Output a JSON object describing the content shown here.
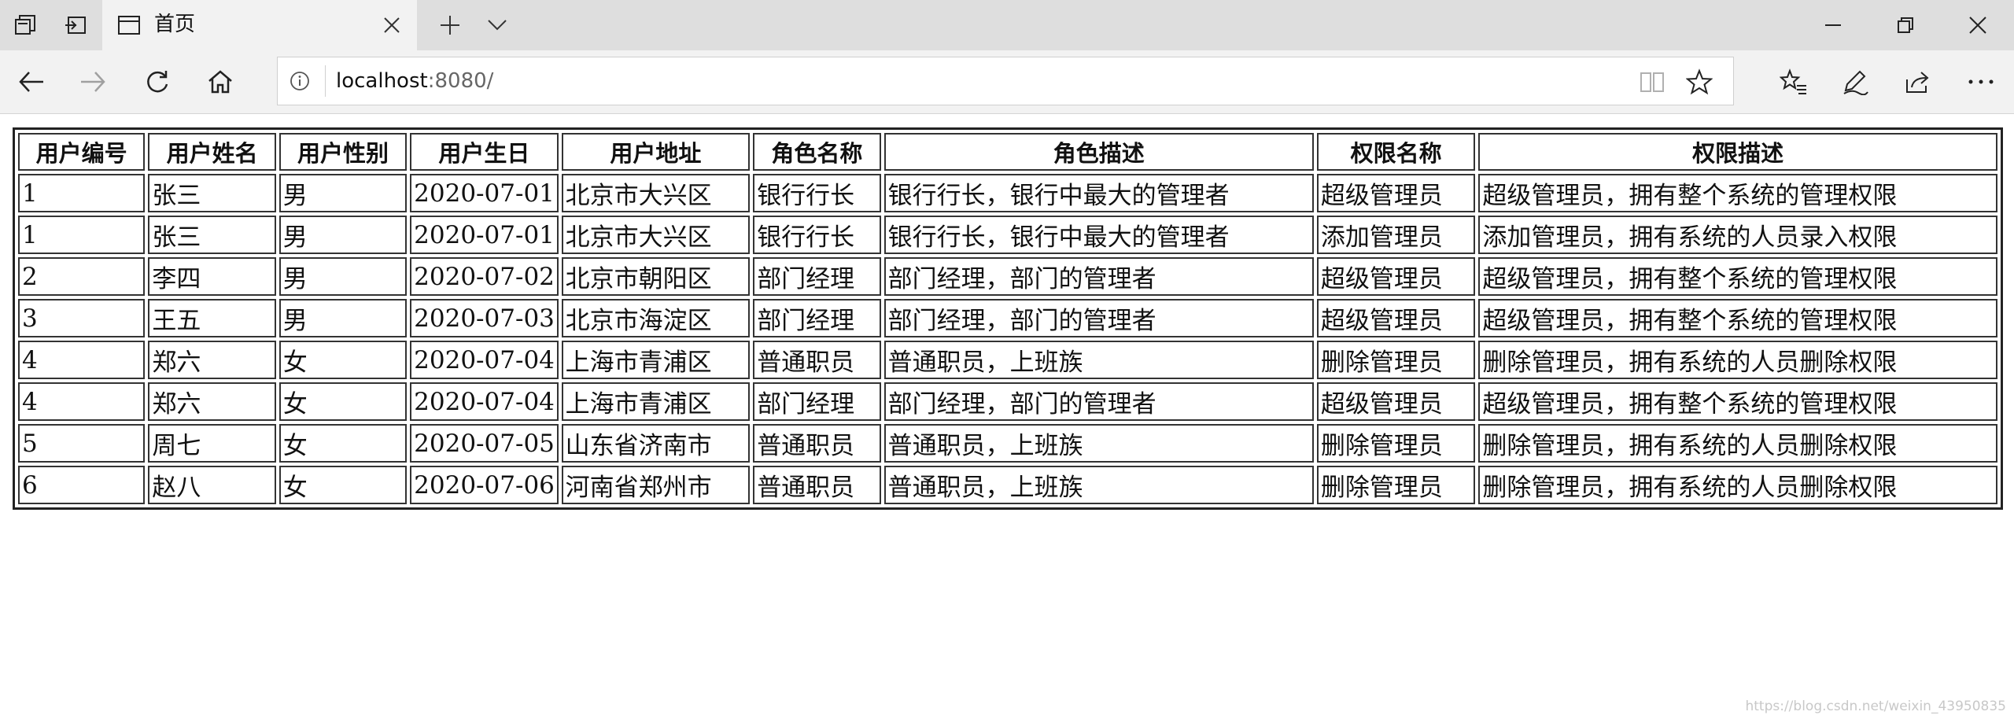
{
  "tab": {
    "title": "首页"
  },
  "address": {
    "host": "localhost",
    "port": ":8080/"
  },
  "table": {
    "headers": [
      "用户编号",
      "用户姓名",
      "用户性别",
      "用户生日",
      "用户地址",
      "角色名称",
      "角色描述",
      "权限名称",
      "权限描述"
    ],
    "rows": [
      [
        "1",
        "张三",
        "男",
        "2020-07-01",
        "北京市大兴区",
        "银行行长",
        "银行行长，银行中最大的管理者",
        "超级管理员",
        "超级管理员，拥有整个系统的管理权限"
      ],
      [
        "1",
        "张三",
        "男",
        "2020-07-01",
        "北京市大兴区",
        "银行行长",
        "银行行长，银行中最大的管理者",
        "添加管理员",
        "添加管理员，拥有系统的人员录入权限"
      ],
      [
        "2",
        "李四",
        "男",
        "2020-07-02",
        "北京市朝阳区",
        "部门经理",
        "部门经理，部门的管理者",
        "超级管理员",
        "超级管理员，拥有整个系统的管理权限"
      ],
      [
        "3",
        "王五",
        "男",
        "2020-07-03",
        "北京市海淀区",
        "部门经理",
        "部门经理，部门的管理者",
        "超级管理员",
        "超级管理员，拥有整个系统的管理权限"
      ],
      [
        "4",
        "郑六",
        "女",
        "2020-07-04",
        "上海市青浦区",
        "普通职员",
        "普通职员，上班族",
        "删除管理员",
        "删除管理员，拥有系统的人员删除权限"
      ],
      [
        "4",
        "郑六",
        "女",
        "2020-07-04",
        "上海市青浦区",
        "部门经理",
        "部门经理，部门的管理者",
        "超级管理员",
        "超级管理员，拥有整个系统的管理权限"
      ],
      [
        "5",
        "周七",
        "女",
        "2020-07-05",
        "山东省济南市",
        "普通职员",
        "普通职员，上班族",
        "删除管理员",
        "删除管理员，拥有系统的人员删除权限"
      ],
      [
        "6",
        "赵八",
        "女",
        "2020-07-06",
        "河南省郑州市",
        "普通职员",
        "普通职员，上班族",
        "删除管理员",
        "删除管理员，拥有系统的人员删除权限"
      ]
    ]
  },
  "watermark": "https://blog.csdn.net/weixin_43950835",
  "icons": {
    "tabs-aside": "tabs-aside-icon",
    "set-aside": "set-aside-icon",
    "page": "page-icon",
    "close": "close-icon",
    "new-tab": "plus-icon",
    "tab-menu": "chevron-down-icon",
    "minimize": "minimize-icon",
    "restore": "restore-icon",
    "window-close": "close-icon",
    "back": "arrow-left-icon",
    "forward": "arrow-right-icon",
    "refresh": "refresh-icon",
    "home": "home-icon",
    "info": "info-icon",
    "reading": "book-icon",
    "favorite": "star-icon",
    "favorites": "favorites-list-icon",
    "notes": "pen-icon",
    "share": "share-icon",
    "more": "more-icon"
  }
}
